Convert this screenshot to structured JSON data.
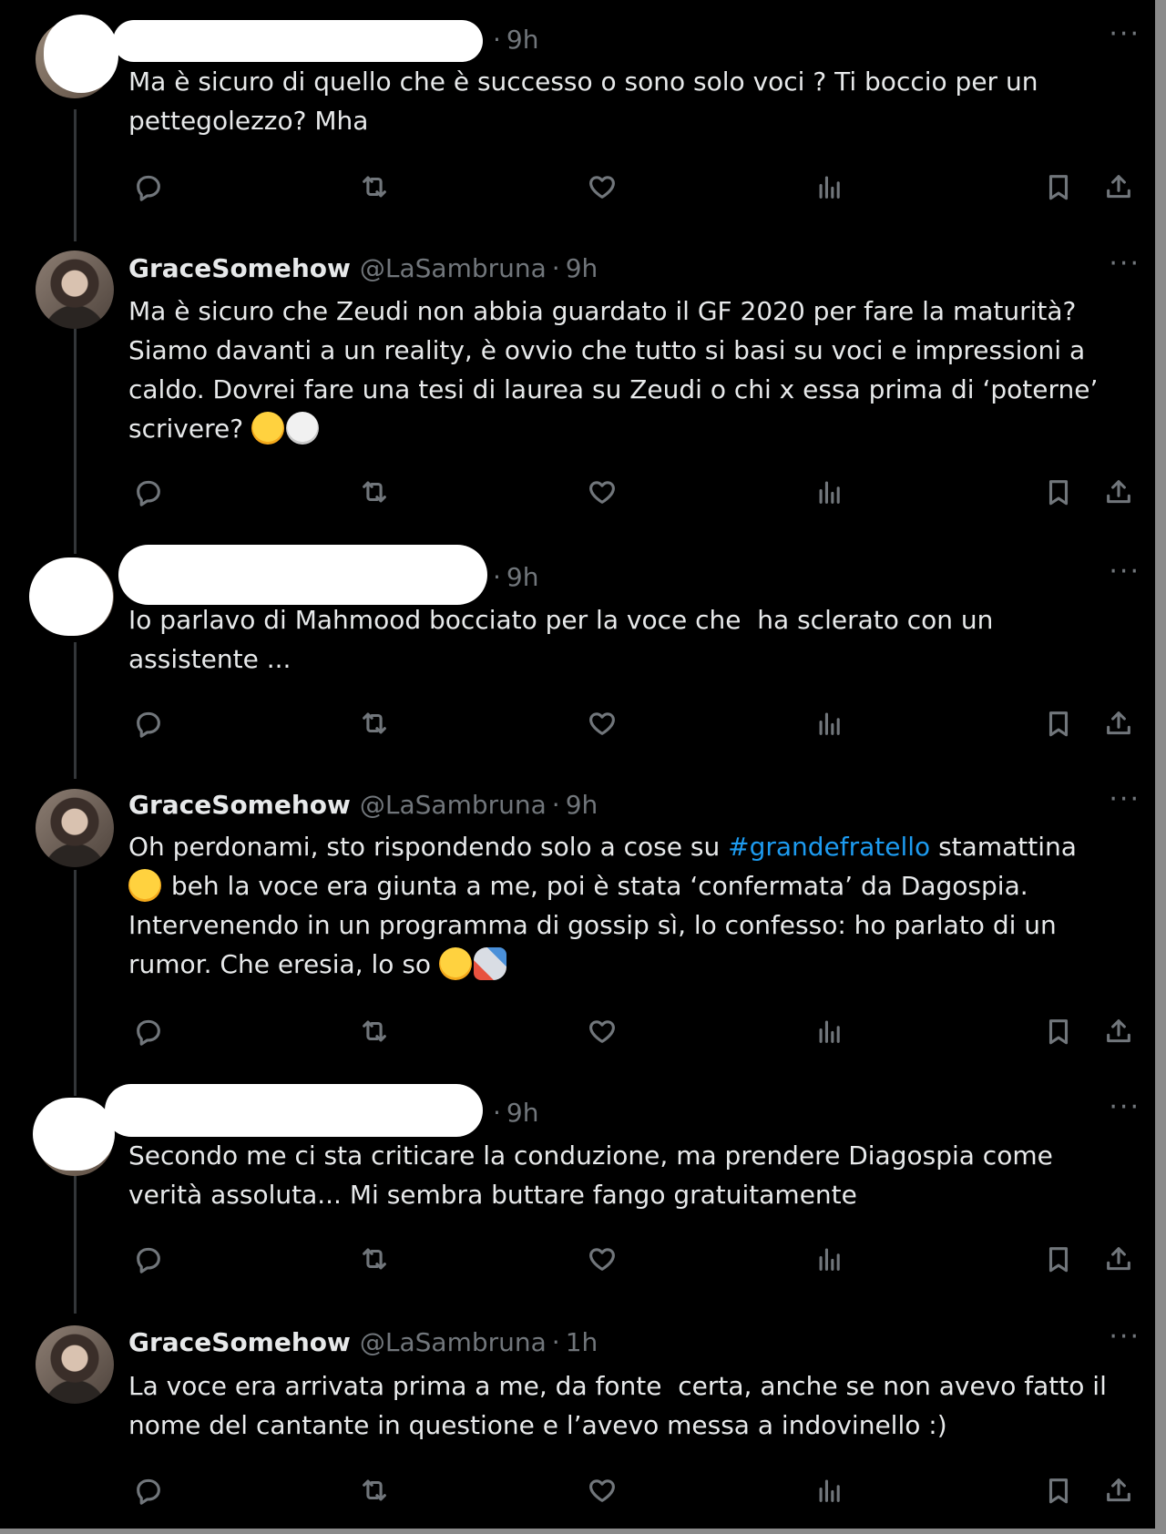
{
  "thread": [
    {
      "author_name": "",
      "handle": "",
      "separator": "·",
      "time": "9h",
      "more": "···",
      "body": "Ma è sicuro di quello che è successo o sono solo voci ? Ti boccio per un\npettegolezzo? Mha",
      "redacted": true
    },
    {
      "author_name": "GraceSomehow",
      "handle": "@LaSambruna",
      "separator": "·",
      "time": "9h",
      "more": "···",
      "body_parts": [
        "Ma è sicuro che Zeudi non abbia guardato il GF 2020 per fare la maturità?\nSiamo davanti a un reality, è ovvio che tutto si basi su voci e impressioni a\ncaldo. Dovrei fare una tesi di laurea su Zeudi o chi x essa prima di ‘poterne’\nscrivere? "
      ],
      "emojis": [
        "rolling-on-floor-laughing",
        "skull"
      ],
      "redacted": false
    },
    {
      "author_name": "",
      "handle": "",
      "separator": "·",
      "time": "9h",
      "more": "···",
      "body": "Io parlavo di Mahmood bocciato per la voce che  ha sclerato con un\nassistente ...",
      "redacted": true
    },
    {
      "author_name": "GraceSomehow",
      "handle": "@LaSambruna",
      "separator": "·",
      "time": "9h",
      "more": "···",
      "body_before_hashtag": "Oh perdonami, sto rispondendo solo a cose su ",
      "hashtag": "#grandefratello",
      "body_after_hashtag": " stamattina",
      "body_line2": " beh la voce era giunta a me, poi è stata ‘confermata’ da Dagospia.",
      "body_line3": "Intervenendo in un programma di gossip sì, lo confesso: ho parlato di un",
      "body_line4": "rumor. Che eresia, lo so ",
      "emojis": [
        "grinning-sweat",
        "rolling-on-floor-laughing",
        "rocket"
      ],
      "redacted": false
    },
    {
      "author_name": "",
      "handle": "",
      "separator": "·",
      "time": "9h",
      "more": "···",
      "body": "Secondo me ci sta criticare la conduzione, ma prendere Diagospia come\nverità assoluta... Mi sembra buttare fango gratuitamente",
      "redacted": true
    },
    {
      "author_name": "GraceSomehow",
      "handle": "@LaSambruna",
      "separator": "·",
      "time": "1h",
      "more": "···",
      "body": "La voce era arrivata prima a me, da fonte  certa, anche se non avevo fatto il\nnome del cantante in questione e l’avevo messa a indovinello :)",
      "redacted": false
    }
  ],
  "action_icons": [
    "reply-icon",
    "retweet-icon",
    "like-icon",
    "views-icon",
    "bookmark-icon",
    "share-icon"
  ],
  "colors": {
    "background": "#000000",
    "text": "#e7e9ea",
    "muted": "#71767b",
    "link": "#1d9bf0",
    "thread_line": "#333639"
  }
}
